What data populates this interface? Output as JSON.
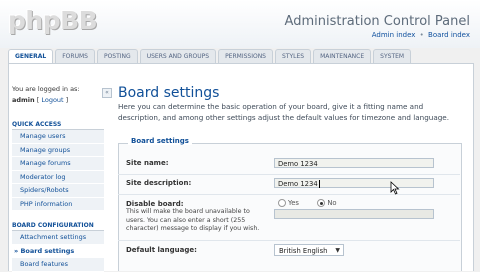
{
  "header": {
    "logo": "phpBB",
    "title": "Administration Control Panel",
    "links": [
      "Admin index",
      "Board index"
    ],
    "link_sep": "•"
  },
  "tabs": [
    "GENERAL",
    "FORUMS",
    "POSTING",
    "USERS AND GROUPS",
    "PERMISSIONS",
    "STYLES",
    "MAINTENANCE",
    "SYSTEM"
  ],
  "active_tab": "GENERAL",
  "sidebar": {
    "logged_in_text": "You are logged in as:",
    "username": "admin",
    "logout_label": "Logout",
    "collapse_glyph": "«",
    "sections": [
      {
        "header": "QUICK ACCESS",
        "items": [
          "Manage users",
          "Manage groups",
          "Manage forums",
          "Moderator log",
          "Spiders/Robots",
          "PHP information"
        ]
      },
      {
        "header": "BOARD CONFIGURATION",
        "items": [
          "Attachment settings",
          "Board settings",
          "Board features"
        ]
      }
    ],
    "active_item": "Board settings"
  },
  "main": {
    "title": "Board settings",
    "description": "Here you can determine the basic operation of your board, give it a fitting name and description, and among other settings adjust the default values for timezone and language.",
    "fieldset_legend": "Board settings",
    "site_name_label": "Site name:",
    "site_name_value": "Demo 1234",
    "site_desc_label": "Site description:",
    "site_desc_value": "Demo 1234",
    "disable_label": "Disable board:",
    "disable_explain": "This will make the board unavailable to users. You can also enter a short (255 character) message to display if you wish.",
    "disable_options": [
      "Yes",
      "No"
    ],
    "disable_selected": "No",
    "language_label": "Default language:",
    "language_value": "British English"
  }
}
